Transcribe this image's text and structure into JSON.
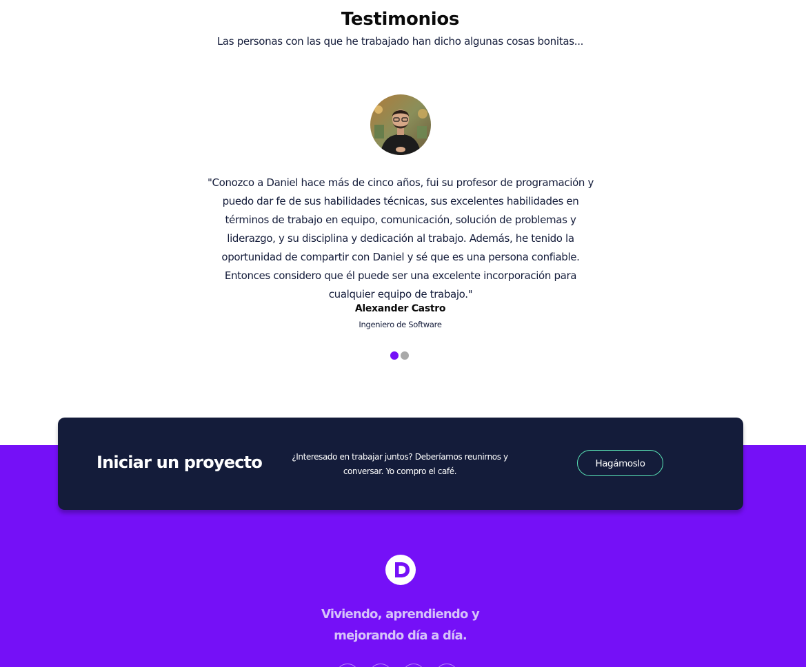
{
  "testimonials": {
    "title": "Testimonios",
    "subtitle": "Las personas con las que he trabajado han dicho algunas cosas bonitas...",
    "active_index": 0,
    "items": [
      {
        "quote": "\"Conozco a Daniel hace más de cinco años, fui su profesor de programación y puedo dar fe de sus habilidades técnicas, sus excelentes habilidades en términos de trabajo en equipo, comunicación, solución de problemas y liderazgo, y su disciplina y dedicación al trabajo. Además, he tenido la oportunidad de compartir con Daniel y sé que es una persona confiable. Entonces considero que él puede ser una excelente incorporación para cualquier equipo de trabajo.\"",
        "name": "Alexander Castro",
        "role": "Ingeniero de Software"
      }
    ]
  },
  "cta": {
    "title": "Iniciar un proyecto",
    "text": "¿Interesado en trabajar juntos? Deberíamos reunirnos y conversar. Yo compro el café.",
    "button_label": "Hagámoslo"
  },
  "footer": {
    "logo_letter": "D",
    "tagline_line1": "Viviendo, aprendiendo y",
    "tagline_line2": "mejorando día a día."
  },
  "colors": {
    "accent": "#7510f7",
    "dark": "#141c3a",
    "button_border": "#5be9b9",
    "dot_inactive": "#a9a9a9",
    "tagline": "#d6c3f9"
  },
  "icons": {
    "avatar": "avatar-photo",
    "footer_logo": "logo-icon",
    "social": [
      "social-icon",
      "social-icon",
      "social-icon",
      "social-icon"
    ]
  }
}
